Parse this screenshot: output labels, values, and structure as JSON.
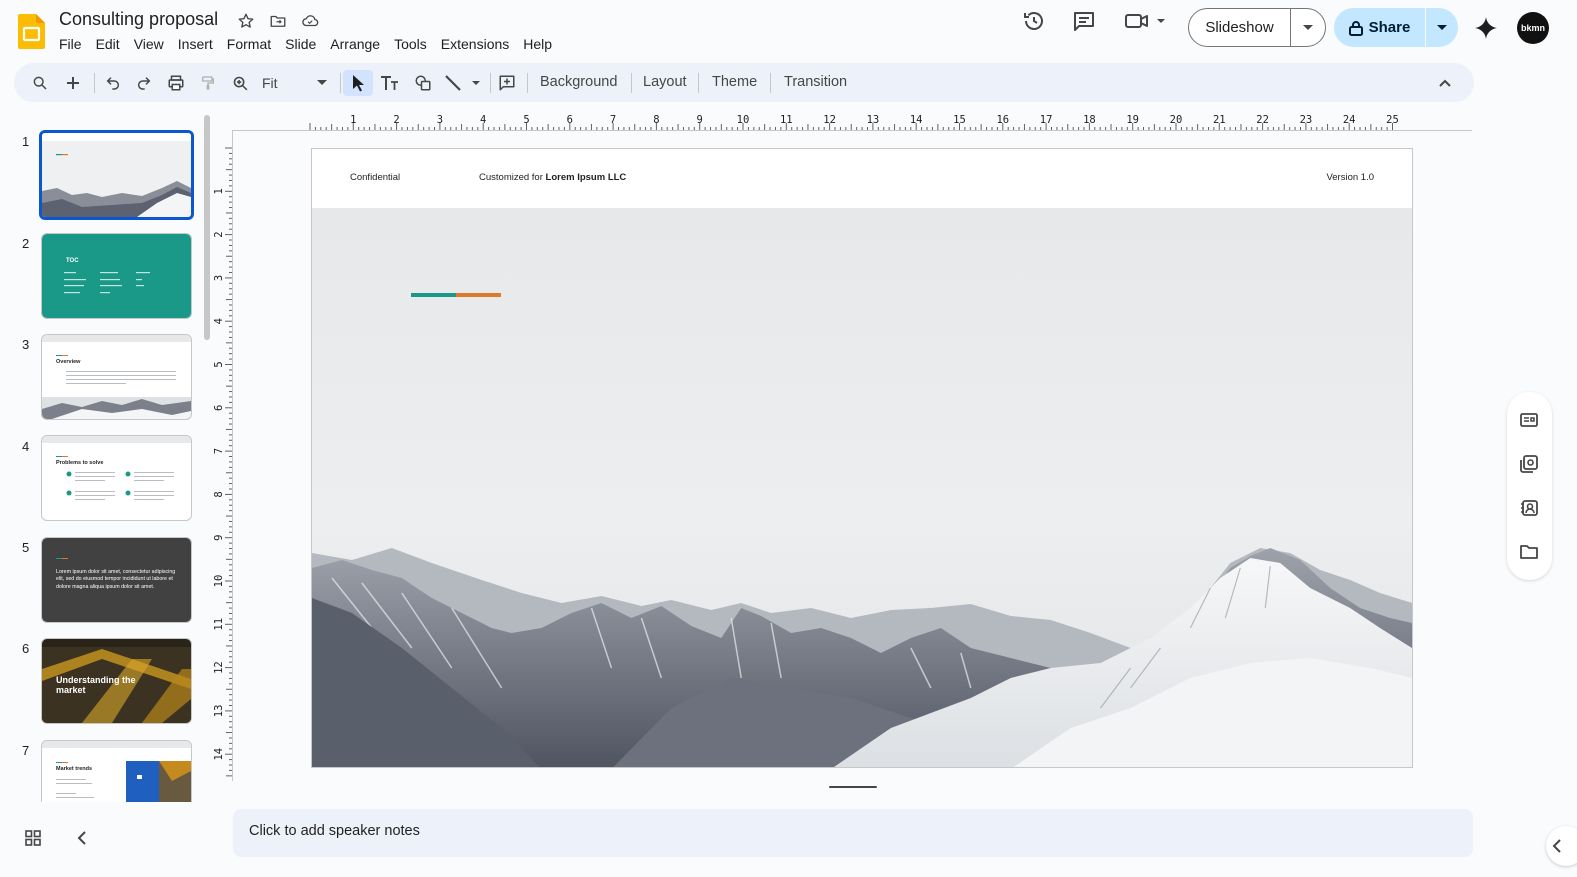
{
  "app": {
    "name": "Google Slides",
    "doc_title": "Consulting proposal"
  },
  "menu": [
    "File",
    "Edit",
    "View",
    "Insert",
    "Format",
    "Slide",
    "Arrange",
    "Tools",
    "Extensions",
    "Help"
  ],
  "header": {
    "slideshow_label": "Slideshow",
    "share_label": "Share",
    "avatar_text": "bkmn"
  },
  "toolbar": {
    "zoom_value": "Fit",
    "background_label": "Background",
    "layout_label": "Layout",
    "theme_label": "Theme",
    "transition_label": "Transition"
  },
  "filmstrip": {
    "slides": [
      {
        "num": "1"
      },
      {
        "num": "2",
        "title": "TOC"
      },
      {
        "num": "3",
        "title": "Overview"
      },
      {
        "num": "4",
        "title": "Problems to solve"
      },
      {
        "num": "5",
        "text": "Lorem ipsum dolor sit amet, consectetur adipiscing elit, sed do eiusmod tempor incididunt ut labore et dolore magna aliqua ipsum dolor sit amet."
      },
      {
        "num": "6",
        "title": "Understanding the market"
      },
      {
        "num": "7",
        "title": "Market trends"
      }
    ]
  },
  "ruler": {
    "h_labels": [
      "1",
      "2",
      "3",
      "4",
      "5",
      "6",
      "7",
      "8",
      "9",
      "10",
      "11",
      "12",
      "13",
      "14",
      "15",
      "16",
      "17",
      "18",
      "19",
      "20",
      "21",
      "22",
      "23",
      "24",
      "25"
    ],
    "v_labels": [
      "1",
      "2",
      "3",
      "4",
      "5",
      "6",
      "7",
      "8",
      "9",
      "10",
      "11",
      "12",
      "13",
      "14"
    ]
  },
  "slide": {
    "confidential": "Confidential",
    "customized_prefix": "Customized for ",
    "customized_client": "Lorem Ipsum LLC",
    "version": "Version 1.0",
    "accent_colors": [
      "#1a9988",
      "#e07a2a"
    ]
  },
  "notes": {
    "placeholder": "Click to add speaker notes"
  },
  "colors": {
    "accent_blue": "#0b57d0",
    "share_bg": "#c2e7ff",
    "toolbar_bg": "#edf2fa"
  }
}
